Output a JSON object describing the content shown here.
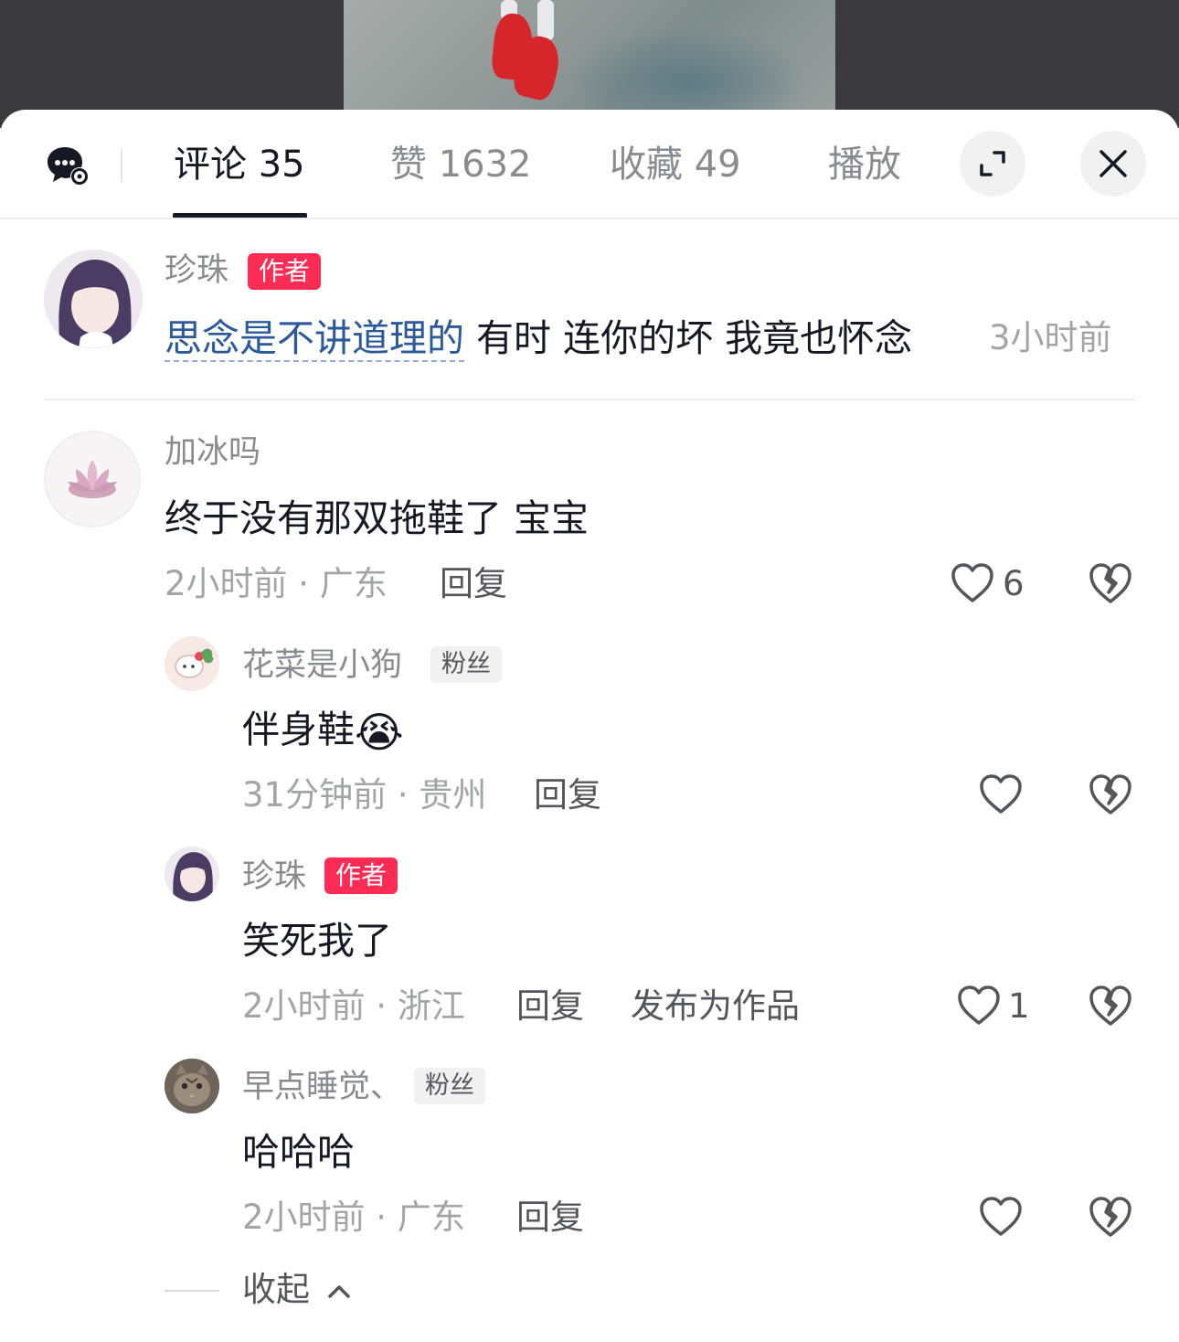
{
  "tabs": [
    {
      "label": "评论 35",
      "active": true
    },
    {
      "label": "赞 1632",
      "active": false
    },
    {
      "label": "收藏 49",
      "active": false
    },
    {
      "label": "播放",
      "active": false
    }
  ],
  "icons": {
    "chat": "chat-settings-icon",
    "expand": "expand-icon",
    "close": "close-icon",
    "like": "heart-outline-icon",
    "dislike": "broken-heart-icon",
    "collapse": "chevron-up-icon"
  },
  "colors": {
    "accent": "#fe2c55",
    "link": "#2b5a9c",
    "muted": "#a3a4a8"
  },
  "author_comment": {
    "name": "珍珠",
    "badge": "作者",
    "link_text": "思念是不讲道理的",
    "text": " 有时 连你的坏 我竟也怀念",
    "time": "3小时前"
  },
  "comments": [
    {
      "name": "加冰吗",
      "text": "终于没有那双拖鞋了 宝宝",
      "meta": "2小时前 · 广东",
      "reply": "回复",
      "likes": "6"
    }
  ],
  "replies": [
    {
      "name": "花菜是小狗",
      "badge": "粉丝",
      "text": "伴身鞋",
      "emoji": "😭",
      "meta": "31分钟前 · 贵州",
      "reply": "回复",
      "likes": ""
    },
    {
      "name": "珍珠",
      "badge": "作者",
      "text": "笑死我了",
      "meta": "2小时前 · 浙江",
      "reply": "回复",
      "extra_action": "发布为作品",
      "likes": "1"
    },
    {
      "name": "早点睡觉、",
      "badge": "粉丝",
      "text": "哈哈哈",
      "meta": "2小时前 · 广东",
      "reply": "回复",
      "likes": ""
    }
  ],
  "collapse_label": "收起"
}
